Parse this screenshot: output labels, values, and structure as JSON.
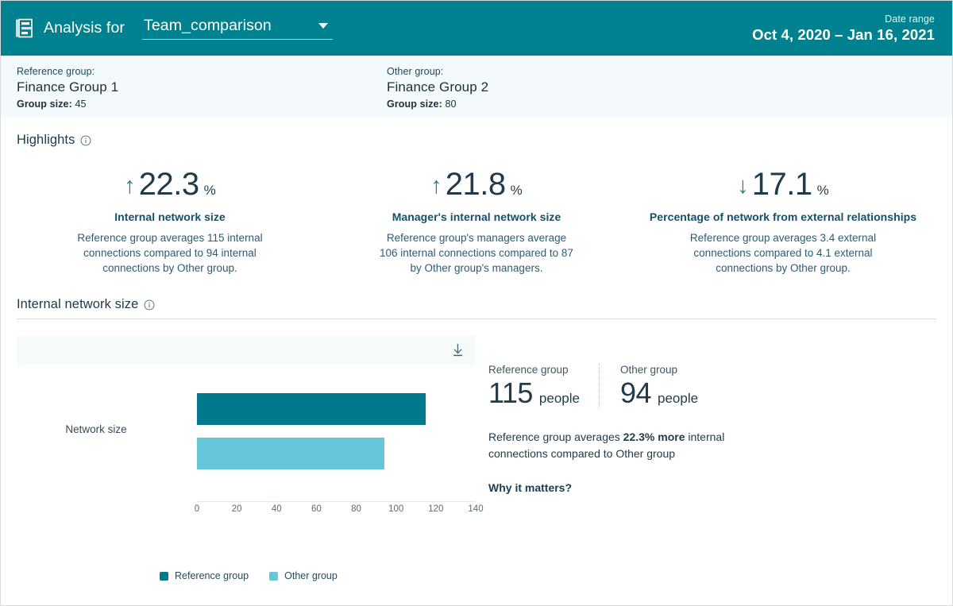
{
  "header": {
    "icon": "report-icon",
    "title": "Analysis for",
    "report_name": "Team_comparison",
    "dropdown_icon": "chevron-down-icon",
    "date_range_label": "Date range",
    "date_range_value": "Oct 4, 2020 – Jan 16, 2021",
    "background_color": "#00818F"
  },
  "groups": {
    "reference": {
      "label": "Reference group:",
      "name": "Finance Group 1",
      "size_label": "Group size:",
      "size_value": "45"
    },
    "other": {
      "label": "Other group:",
      "name": "Finance Group 2",
      "size_label": "Group size:",
      "size_value": "80"
    }
  },
  "highlights": {
    "heading": "Highlights",
    "info_icon": "info-icon",
    "cards": [
      {
        "direction_icon": "arrow-up-icon",
        "arrow": "↑",
        "value": "22.3",
        "unit": "%",
        "name": "Internal network size",
        "description": "Reference group averages 115 internal connections compared to 94 internal connections by Other group."
      },
      {
        "direction_icon": "arrow-up-icon",
        "arrow": "↑",
        "value": "21.8",
        "unit": "%",
        "name": "Manager's internal network size",
        "description": "Reference group's managers average 106 internal connections compared to 87 by Other group's managers."
      },
      {
        "direction_icon": "arrow-down-icon",
        "arrow": "↓",
        "value": "17.1",
        "unit": "%",
        "name": "Percentage of network from external relationships",
        "description": "Reference group averages 3.4 external connections compared to 4.1 external connections by Other group."
      }
    ]
  },
  "internal_network_size": {
    "heading": "Internal network size",
    "info_icon": "info-icon",
    "download_icon": "download-icon",
    "stats": {
      "reference": {
        "label": "Reference group",
        "value": "115",
        "unit": "people"
      },
      "other": {
        "label": "Other group",
        "value": "94",
        "unit": "people"
      }
    },
    "description_before": "Reference group averages ",
    "description_bold": "22.3% more",
    "description_after": " internal connections compared to Other group",
    "why_link": "Why it matters?"
  },
  "chart_data": {
    "type": "bar",
    "orientation": "horizontal",
    "title": "Internal network size",
    "categories": [
      "Network size"
    ],
    "series": [
      {
        "name": "Reference group",
        "values": [
          115
        ],
        "color": "#00798C"
      },
      {
        "name": "Other group",
        "values": [
          94
        ],
        "color": "#67C6D8"
      }
    ],
    "xlabel": "",
    "ylabel": "Network size",
    "xlim": [
      0,
      140
    ],
    "xticks": [
      0,
      20,
      40,
      60,
      80,
      100,
      120,
      140
    ],
    "xtick_labels": [
      "0",
      "20",
      "40",
      "60",
      "80",
      "100",
      "120",
      "140"
    ],
    "grid": false,
    "legend_position": "bottom",
    "legend": [
      "Reference group",
      "Other group"
    ]
  }
}
